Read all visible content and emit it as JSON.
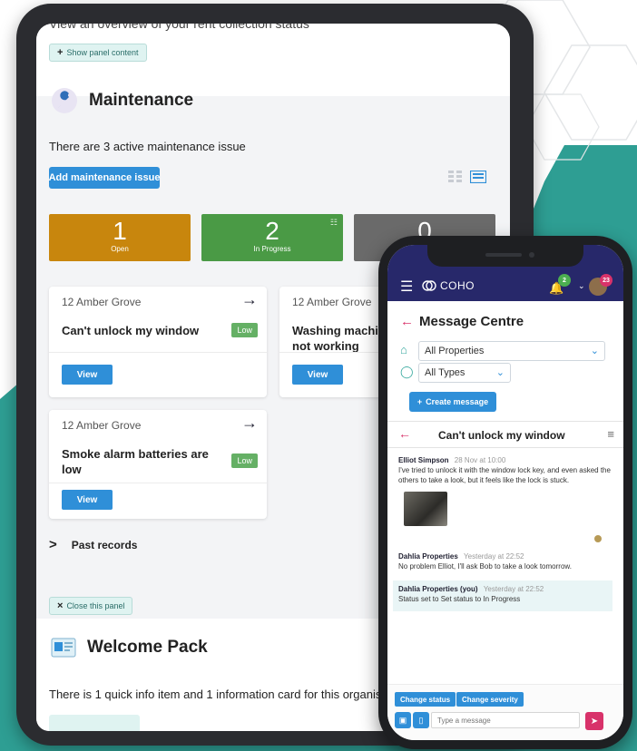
{
  "colors": {
    "teal": "#2e9e93",
    "blue": "#2f8fd8",
    "open": "#c8860d",
    "in_progress": "#4a9a45",
    "closed": "#6a6a6a",
    "navy": "#27286a",
    "accent": "#d8326a"
  },
  "tablet": {
    "cut_heading": "View an overview of your rent collection status",
    "show_panel_btn": "Show panel content",
    "maintenance": {
      "title": "Maintenance",
      "summary": "There are 3 active maintenance issue",
      "add_button": "Add maintenance issue",
      "stats": [
        {
          "value": "1",
          "label": "Open"
        },
        {
          "value": "2",
          "label": "In Progress"
        },
        {
          "value": "0",
          "label": ""
        }
      ],
      "cards": [
        {
          "address": "12 Amber Grove",
          "title": "Can't unlock my window",
          "severity": "Low",
          "view": "View"
        },
        {
          "address": "12 Amber Grove",
          "title": "Washing machine not working",
          "severity": "",
          "view": "View"
        },
        {
          "address": "12 Amber Grove",
          "title": "Smoke alarm batteries are low",
          "severity": "Low",
          "view": "View"
        }
      ],
      "past_records": "Past records",
      "close_panel_btn": "Close this panel"
    },
    "welcome": {
      "title": "Welcome Pack",
      "summary": "There is 1 quick info item and 1 information card for this organisation"
    }
  },
  "phone": {
    "brand": "COHO",
    "notifications_count": "2",
    "messages_count": "23",
    "title": "Message Centre",
    "property_filter": "All Properties",
    "type_filter": "All Types",
    "create_button": "Create message",
    "thread_title": "Can't unlock my window",
    "messages": [
      {
        "author": "Elliot Simpson",
        "time": "28 Nov at 10:00",
        "text": "I've tried to unlock it with the window lock key, and even asked the others to take a look, but it feels like the lock is stuck."
      },
      {
        "author": "Dahlia Properties",
        "time": "Yesterday at 22:52",
        "text": "No problem Elliot, I'll ask Bob to take a look tomorrow."
      },
      {
        "author": "Dahlia Properties (you)",
        "time": "Yesterday at 22:52",
        "text": "Status set to Set status to In Progress"
      }
    ],
    "change_status": "Change status",
    "change_severity": "Change severity",
    "input_placeholder": "Type a message"
  }
}
